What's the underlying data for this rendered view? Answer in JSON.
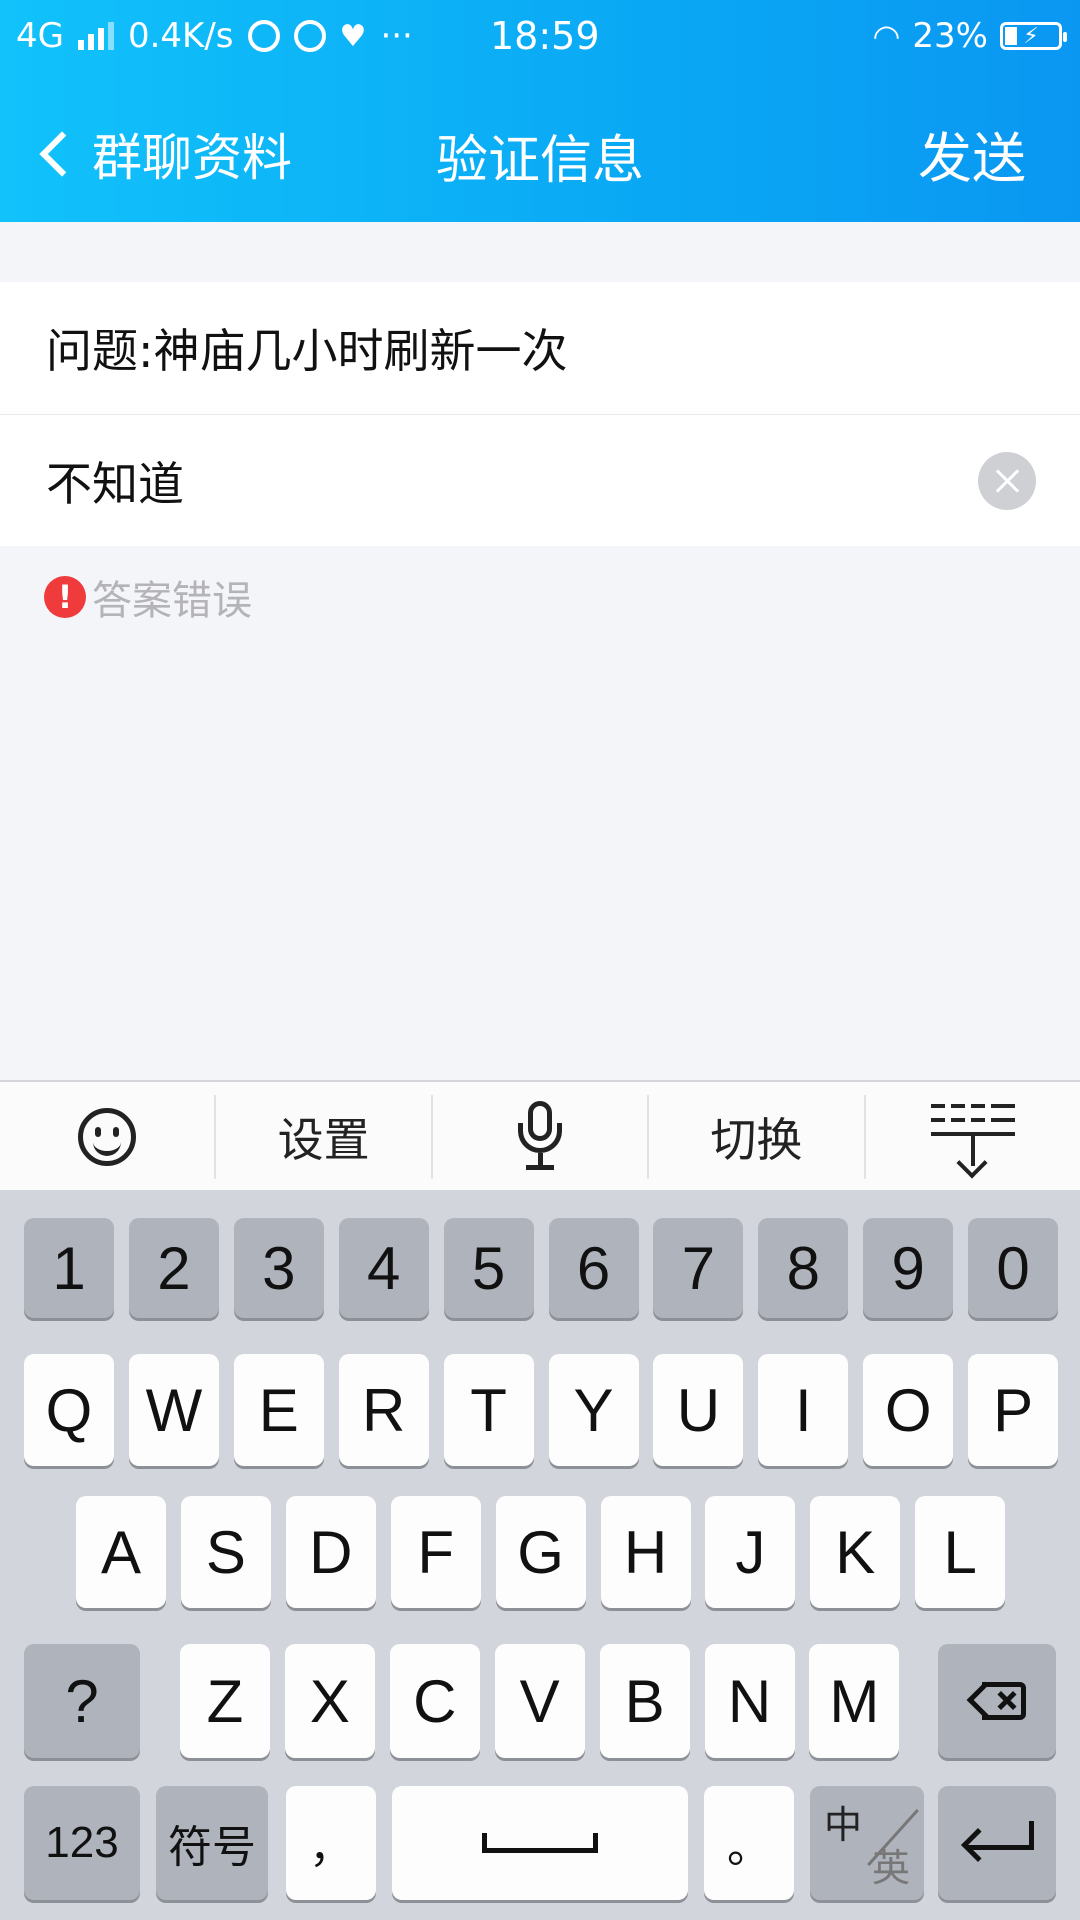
{
  "status_bar": {
    "network": "4G",
    "speed": "0.4K/s",
    "more": "···",
    "time": "18:59",
    "battery": "23%",
    "battery_fraction": 0.23
  },
  "nav": {
    "back_label": "群聊资料",
    "title": "验证信息",
    "send_label": "发送"
  },
  "form": {
    "question": "问题:神庙几小时刷新一次",
    "answer_value": "不知道",
    "error_text": "答案错误"
  },
  "toolbar": {
    "settings_label": "设置",
    "switch_label": "切换"
  },
  "keyboard": {
    "row_numbers": [
      "1",
      "2",
      "3",
      "4",
      "5",
      "6",
      "7",
      "8",
      "9",
      "0"
    ],
    "row_q": [
      "Q",
      "W",
      "E",
      "R",
      "T",
      "Y",
      "U",
      "I",
      "O",
      "P"
    ],
    "row_a": [
      "A",
      "S",
      "D",
      "F",
      "G",
      "H",
      "J",
      "K",
      "L"
    ],
    "row_z": [
      "Z",
      "X",
      "C",
      "V",
      "B",
      "N",
      "M"
    ],
    "question_key": "?",
    "num_key": "123",
    "symbol_key": "符号",
    "comma_key": "，",
    "period_key": "。",
    "lang_zh": "中",
    "lang_en": "英"
  },
  "colors": {
    "header_gradient_start": "#11c2fb",
    "header_gradient_end": "#0a97f2",
    "error_red": "#ef3b3b"
  }
}
